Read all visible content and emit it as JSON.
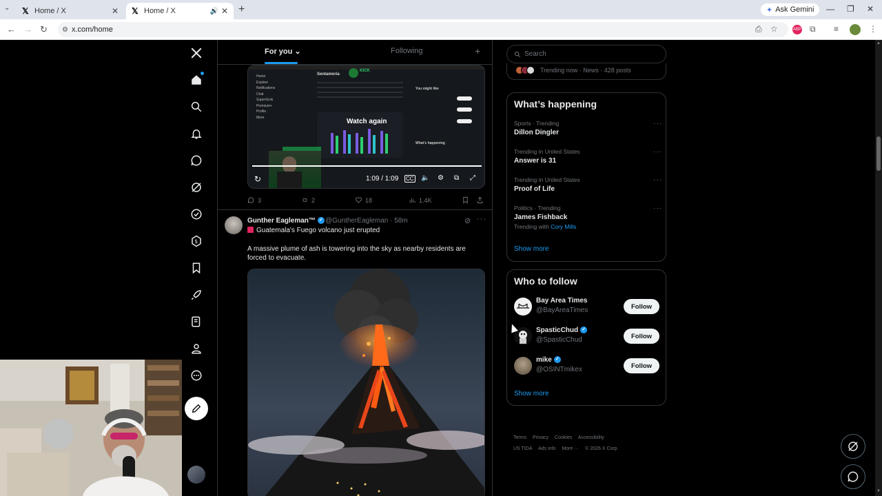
{
  "browser": {
    "tabs": [
      {
        "title": "Home / X"
      },
      {
        "title": "Home / X"
      }
    ],
    "gemini_label": "Ask Gemini",
    "url": "x.com/home"
  },
  "feed": {
    "tabs": {
      "for_you": "For you",
      "following": "Following"
    },
    "video": {
      "overlay_text": "Watch again",
      "time": "1:09 / 1:09",
      "mini_text": {
        "account": "Sentamoria",
        "sidebar": [
          "Home",
          "Explore",
          "Notifications",
          "Chat",
          "SuperGrok",
          "Premium+",
          "Profile",
          "More"
        ],
        "right_panel": [
          "You might like",
          "What's happening"
        ],
        "badge": "KICK"
      }
    },
    "actions": {
      "replies": "3",
      "reposts": "2",
      "likes": "18",
      "views": "1.4K"
    },
    "post": {
      "name": "Gunther Eagleman™",
      "handle": "@GuntherEagleman",
      "time": "· 58m",
      "line1": "Guatemala's Fuego volcano just erupted",
      "line2": "A massive plume of ash is towering into the sky as nearby residents are forced to evacuate."
    }
  },
  "sidebar_right": {
    "search_placeholder": "Search",
    "trending_now": "Trending now · News · 428 posts",
    "happening_title": "What’s happening",
    "trends": [
      {
        "context": "Sports · Trending",
        "name": "Dillon Dingler",
        "with_label": "",
        "with_link": ""
      },
      {
        "context": "Trending in United States",
        "name": "Answer is 31",
        "with_label": "",
        "with_link": ""
      },
      {
        "context": "Trending in United States",
        "name": "Proof of Life",
        "with_label": "",
        "with_link": ""
      },
      {
        "context": "Politics · Trending",
        "name": "James Fishback",
        "with_label": "Trending with",
        "with_link": "Cory Mills"
      }
    ],
    "show_more": "Show more",
    "follow_title": "Who to follow",
    "follow": [
      {
        "name": "Bay Area Times",
        "handle": "@BayAreaTimes",
        "button": "Follow"
      },
      {
        "name": "SpasticChud",
        "handle": "@SpasticChud",
        "button": "Follow"
      },
      {
        "name": "mike",
        "handle": "@OSINTmikex",
        "button": "Follow"
      }
    ],
    "follow_show_more": "Show more",
    "footer": {
      "links": [
        "Terms",
        "Privacy",
        "Cookies",
        "Accessibility"
      ],
      "links2": [
        "US TIDA",
        "Ads info",
        "More ···",
        "© 2026 X Corp."
      ]
    }
  },
  "colors": {
    "accent": "#1d9bf0",
    "bg": "#000000",
    "border": "#2f3336",
    "muted": "#71767b"
  }
}
